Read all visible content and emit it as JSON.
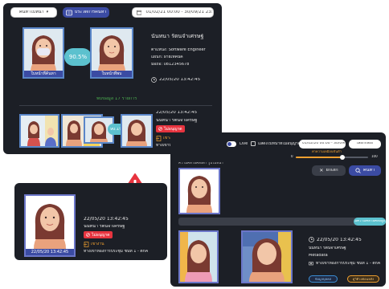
{
  "main": {
    "search_label": "ค้นหาใบหน้า",
    "search_arrow": "▾",
    "history_label": "ประวัติการค้นหา",
    "date_range": "01/02/21 00:00 - 30/09/21 23:59",
    "similarity": "90.5%",
    "left_caption": "ใบหน้าที่ค้นหา",
    "right_caption": "ใบหน้าที่พบ",
    "person_name": "นันทนา รัตนจำเศรษฐ์",
    "position": "ตำแหน่ง: Software Engineer",
    "department": "แผนก: ฝ่ายเทคนิค",
    "phone": "มือถือ: 0812345678",
    "datetime": "22/05/20   13:42:45",
    "found_count": "พบข้อมูล 17 รายการ",
    "detail_datetime": "22/05/20   13:42:45",
    "detail_name": "นันทนา รัตนจำเศรษฐ์",
    "blacklist": "ไม่อนุญาต",
    "entry_label": "เข้างาน",
    "location": "ทางเข้าห้องการประชุม ชั้นที่ 1 - ตึกA",
    "thumb_sim": "90.1%"
  },
  "alert": {
    "datetime": "22/05/20   13:42:45",
    "name": "นันทนา รัตนจำเศรษฐ์",
    "blacklist": "ไม่อนุญาต",
    "entry_label": "เข้างาน",
    "location": "ทางเข้าห้องการประชุม ชั้นที่ 1 - ตึกA",
    "caption": "22/05/20  13:42:45"
  },
  "right": {
    "live_label": "Live",
    "record_label": "แสดงใบหน้าที่ไม่อนุญาต",
    "date_range": "01/02/20 00:00 - 30/09/20",
    "select_label": "เลือกกล้อง",
    "slider_label": "ค่าความเหมือนขั้นต่ำ",
    "slider_min": "0",
    "slider_max": "100",
    "slider_percent": 65,
    "similarity_label": "ความคล้ายคลึงต่ำ รูปใบหน้า",
    "cancel_label": "ยกเลิก",
    "search_label": "ค้นหา",
    "badge": "มีความคล้ายคลึงสูง",
    "datetime": "22/05/20   13:42:45",
    "name": "นันทนา รัตนจำเศรษฐ์",
    "meta": "Metadata",
    "location": "ทางเข้าห้องการประชุม ชั้นที่ 1 - ตึกA",
    "btn_left": "ข้อมูลบุคคล",
    "btn_right": "ดูวิดีโอย้อนหลัง"
  },
  "colors": {
    "panel": "#1c1f26",
    "accent": "#3b4ba3",
    "danger": "#e7343f",
    "green": "#4caf50",
    "teal": "#5cc1ce"
  }
}
